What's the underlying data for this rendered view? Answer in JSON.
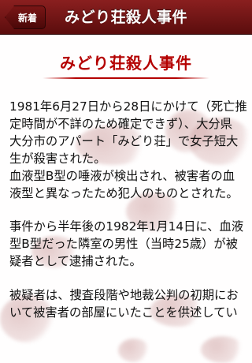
{
  "nav": {
    "back_label": "新着",
    "title": "みどり荘殺人事件"
  },
  "article": {
    "title": "みどり荘殺人事件",
    "paragraphs": [
      "1981年6月27日から28日にかけて（死亡推\n定時間が不詳のため確定できず）、大分県\n大分市のアパート「みどり荘」で女子短大\n生が殺害された。",
      "血液型B型の唾液が検出され、被害者の血\n液型と異なったため犯人のものとされた。",
      "事件から半年後の1982年1月14日に、血液\n型B型だった隣室の男性（当時25歳）が被\n疑者として逮捕された。",
      "被疑者は、捜査段階や地裁公判の初期にお\nいて被害者の部屋にいたことを供述してい"
    ]
  },
  "colors": {
    "nav_background": "#6e1414",
    "title_color": "#b40000",
    "text_color": "#111111"
  }
}
